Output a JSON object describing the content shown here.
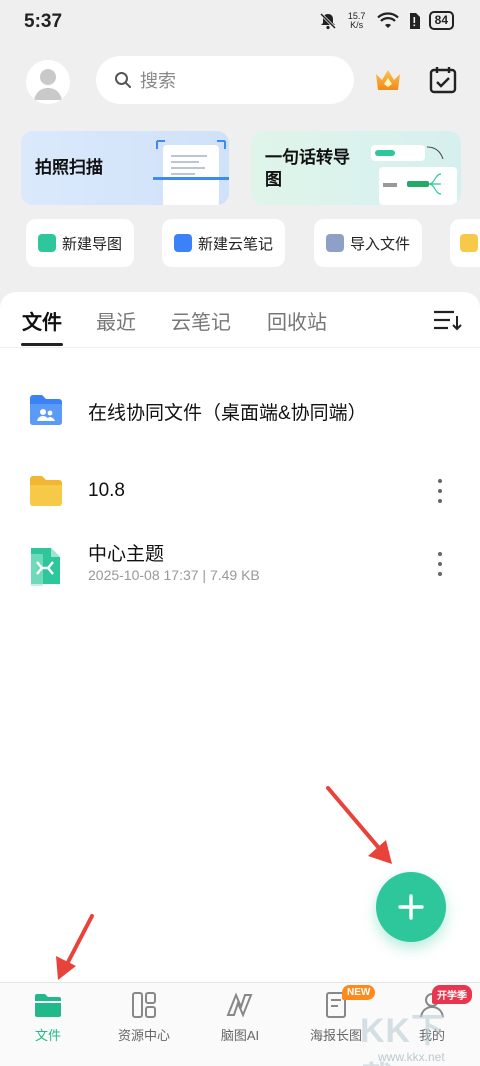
{
  "status": {
    "time": "5:37",
    "net_speed_top": "15.7",
    "net_speed_bottom": "K/s",
    "battery": "84"
  },
  "search": {
    "placeholder": "搜索"
  },
  "cards": [
    {
      "title": "拍照扫描"
    },
    {
      "title_line1": "一句话转导",
      "title_line2": "图"
    }
  ],
  "quick_actions": [
    {
      "label": "新建导图"
    },
    {
      "label": "新建云笔记"
    },
    {
      "label": "导入文件"
    }
  ],
  "tabs": [
    {
      "label": "文件"
    },
    {
      "label": "最近"
    },
    {
      "label": "云笔记"
    },
    {
      "label": "回收站"
    }
  ],
  "files": [
    {
      "name": "在线协同文件（桌面端&协同端）"
    },
    {
      "name": "10.8"
    },
    {
      "name": "中心主题",
      "meta": "2025-10-08 17:37 | 7.49 KB"
    }
  ],
  "bottom_nav": [
    {
      "label": "文件"
    },
    {
      "label": "资源中心"
    },
    {
      "label": "脑图AI"
    },
    {
      "label": "海报长图",
      "badge": "NEW"
    },
    {
      "label": "我的",
      "badge": "开学季"
    }
  ],
  "watermark": {
    "text": "KK下载",
    "url": "www.kkx.net"
  },
  "colors": {
    "accent": "#2dc79b",
    "arrow": "#e8423a",
    "folder_yellow": "#f7c948",
    "folder_blue": "#3b82f6"
  }
}
